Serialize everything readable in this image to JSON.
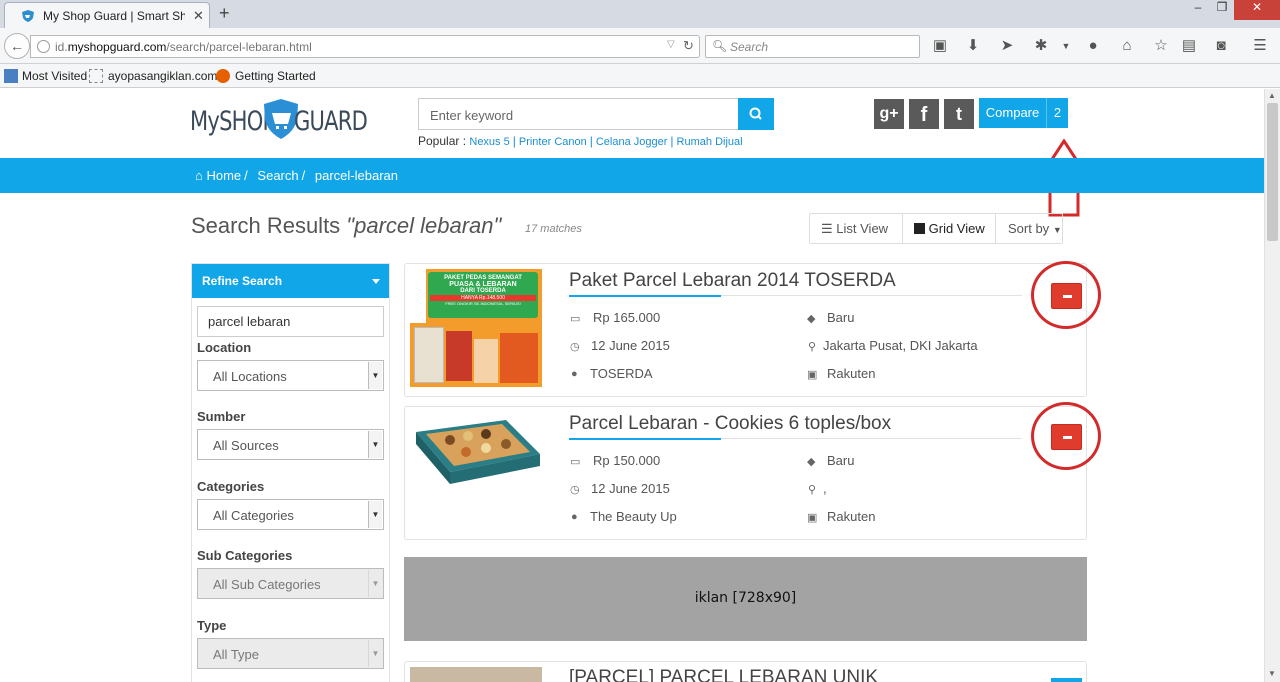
{
  "browser": {
    "tab_title": "My Shop Guard | Smart Sh...",
    "url_domain_prefix": "id.",
    "url_domain": "myshopguard.com",
    "url_path": "/search/parcel-lebaran.html",
    "search_placeholder": "Search",
    "bookmarks": [
      "Most Visited",
      "ayopasangiklan.com",
      "Getting Started"
    ]
  },
  "site": {
    "logo_left": "MySHOP",
    "logo_right": "GUARD",
    "keyword_placeholder": "Enter keyword",
    "popular_label": "Popular :",
    "popular_links": [
      "Nexus 5",
      "Printer Canon",
      "Celana Jogger",
      "Rumah Dijual"
    ],
    "social": [
      "g+",
      "f",
      "t"
    ],
    "compare_label": "Compare",
    "compare_count": "2"
  },
  "breadcrumb": {
    "home": "Home",
    "search": "Search",
    "current": "parcel-lebaran"
  },
  "results": {
    "title_prefix": "Search Results ",
    "query": "\"parcel lebaran\"",
    "matches": "17 matches",
    "list_view": "List View",
    "grid_view": "Grid View",
    "sort_by": "Sort by"
  },
  "sidebar": {
    "refine": "Refine Search",
    "search_value": "parcel lebaran",
    "location_label": "Location",
    "location_value": "All Locations",
    "sumber_label": "Sumber",
    "sumber_value": "All Sources",
    "categories_label": "Categories",
    "categories_value": "All Categories",
    "subcategories_label": "Sub Categories",
    "subcategories_value": "All Sub Categories",
    "type_label": "Type",
    "type_value": "All Type"
  },
  "items": [
    {
      "title": "Paket Parcel Lebaran 2014 TOSERDA",
      "price": "Rp 165.000",
      "date": "12 June 2015",
      "seller": "TOSERDA",
      "condition": "Baru",
      "location": "Jakarta Pusat, DKI Jakarta",
      "source": "Rakuten",
      "thumb_lines": [
        "PAKET PEDAS SEMANGAT",
        "PUASA & LEBARAN",
        "DARI TOSERDA",
        "HANYA Rp.148.500",
        "FREE ONGKIR SE-INDONESIA, SERIUS!"
      ]
    },
    {
      "title": "Parcel Lebaran - Cookies 6 toples/box",
      "price": "Rp 150.000",
      "date": "12 June 2015",
      "seller": "The Beauty Up",
      "condition": "Baru",
      "location": ",",
      "source": "Rakuten"
    },
    {
      "title": "[PARCEL] PARCEL LEBARAN UNIK"
    }
  ],
  "ad_text": "iklan [728x90]",
  "colors": {
    "accent": "#10a6e8",
    "remove": "#e03c2e",
    "annotation": "#d32b2b"
  }
}
